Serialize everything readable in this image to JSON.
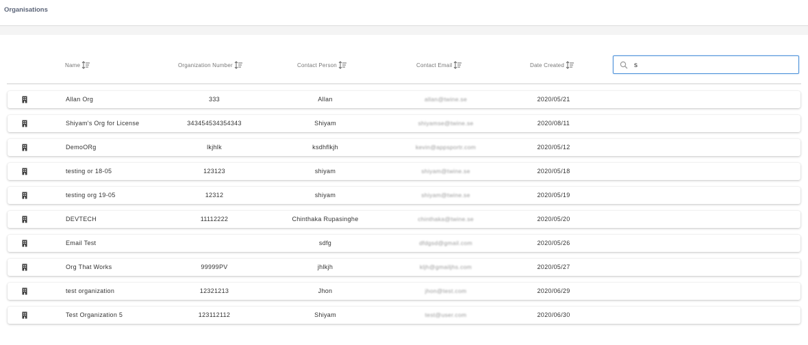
{
  "header": {
    "title": "Organisations"
  },
  "table": {
    "columns": {
      "name": "Name",
      "org_number": "Organization Number",
      "contact_person": "Contact Person",
      "contact_email": "Contact Email",
      "date_created": "Date Created"
    },
    "search": {
      "value": "s",
      "placeholder": ""
    },
    "rows": [
      {
        "name": "Allan Org",
        "org_number": "333",
        "contact_person": "Allan",
        "contact_email": "allan@twine.se",
        "date_created": "2020/05/21"
      },
      {
        "name": "Shiyam's Org for License",
        "org_number": "343454534354343",
        "contact_person": "Shiyam",
        "contact_email": "shiyamse@twine.se",
        "date_created": "2020/08/11"
      },
      {
        "name": "DemoORg",
        "org_number": "lkjhlk",
        "contact_person": "ksdhflkjh",
        "contact_email": "kevin@appsportr.com",
        "date_created": "2020/05/12"
      },
      {
        "name": "testing or 18-05",
        "org_number": "123123",
        "contact_person": "shiyam",
        "contact_email": "shiyam@twine.se",
        "date_created": "2020/05/18"
      },
      {
        "name": "testing org 19-05",
        "org_number": "12312",
        "contact_person": "shiyam",
        "contact_email": "shiyam@twine.se",
        "date_created": "2020/05/19"
      },
      {
        "name": "DEVTECH",
        "org_number": "11112222",
        "contact_person": "Chinthaka Rupasinghe",
        "contact_email": "chinthaka@twine.se",
        "date_created": "2020/05/20"
      },
      {
        "name": "Email Test",
        "org_number": "",
        "contact_person": "sdfg",
        "contact_email": "dfdgsd@gmail.com",
        "date_created": "2020/05/26"
      },
      {
        "name": "Org That Works",
        "org_number": "99999PV",
        "contact_person": "jhlkjh",
        "contact_email": "kljh@gmailjhs.com",
        "date_created": "2020/05/27"
      },
      {
        "name": "test organization",
        "org_number": "12321213",
        "contact_person": "Jhon",
        "contact_email": "jhon@test.com",
        "date_created": "2020/06/29"
      },
      {
        "name": "Test Organization 5",
        "org_number": "123112112",
        "contact_person": "Shiyam",
        "contact_email": "test@user.com",
        "date_created": "2020/06/30"
      }
    ]
  }
}
